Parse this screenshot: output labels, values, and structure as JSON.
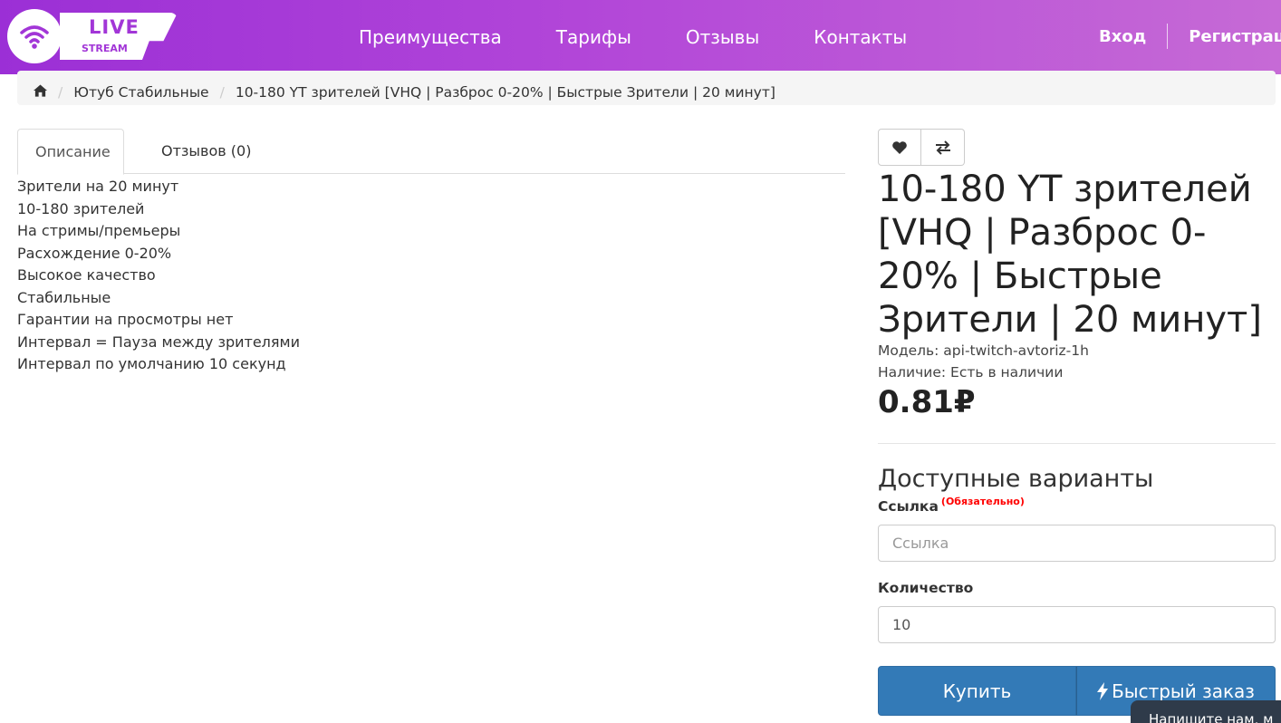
{
  "header": {
    "logo": {
      "live": "LIVE",
      "stream": "STREAM"
    },
    "nav": [
      "Преимущества",
      "Тарифы",
      "Отзывы",
      "Контакты"
    ],
    "login": "Вход",
    "register": "Регистрация",
    "gradient": [
      "#9b2fd6",
      "#c66ad6"
    ]
  },
  "breadcrumb": {
    "home_icon": "home-icon",
    "items": [
      "Ютуб Стабильные",
      "10-180 YT зрителей [VHQ | Разброс 0-20% | Быстрые Зрители | 20 минут]"
    ]
  },
  "tabs": {
    "description": "Описание",
    "reviews": "Отзывов (0)"
  },
  "description_lines": [
    "Зрители на 20 минут",
    "10-180 зрителей",
    "На стримы/премьеры",
    "Расхождение 0-20%",
    "Высокое качество",
    "Стабильные",
    "Гарантии на просмотры нет",
    "Интервал = Пауза между зрителями",
    "Интервал по умолчанию 10 секунд"
  ],
  "product": {
    "title": "10-180 YT зрителей [VHQ | Разброс 0-20% | Быстрые Зрители | 20 минут]",
    "model": "Модель: api-twitch-avtoriz-1h",
    "availability": "Наличие: Есть в наличии",
    "price": "0.81₽",
    "wishlist_icon": "heart-icon",
    "compare_icon": "exchange-icon"
  },
  "options": {
    "title": "Доступные варианты",
    "link_label": "Ссылка",
    "required": "(Обязательно)",
    "link_placeholder": "Ссылка",
    "quantity_label": "Количество",
    "quantity_value": "10"
  },
  "actions": {
    "buy": "Купить",
    "quick_order": "Быстрый заказ",
    "accent": "#337ab7"
  },
  "chat": {
    "text": "Напишите нам, м"
  }
}
